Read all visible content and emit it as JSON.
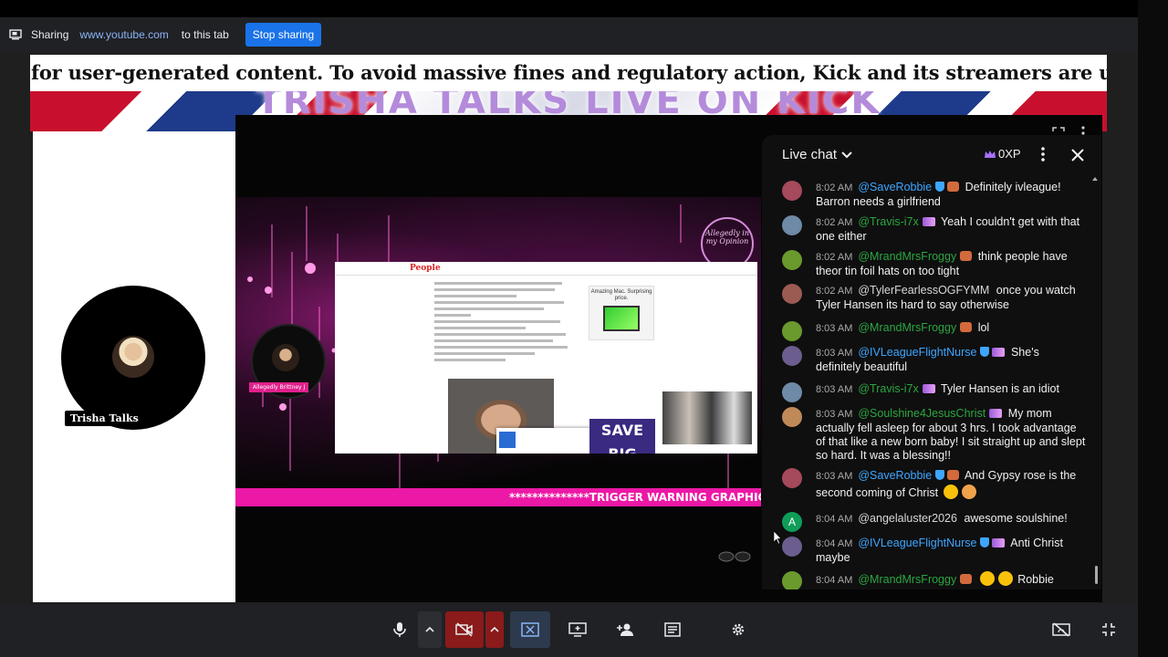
{
  "share_bar": {
    "label": "Sharing",
    "url": "www.youtube.com",
    "suffix": "to this tab",
    "stop_button": "Stop sharing"
  },
  "stream": {
    "ticker_text": "for user-generated content. To avoid massive fines and regulatory action, Kick and its streamers are utilising age",
    "banner_title": "TRISHA TALKS LIVE ON KICK",
    "host_name": "Trisha Talks",
    "guest_name": "Allegedly Brittney J",
    "logo_text": "Allegedly in my Opinion",
    "warning_text": "**************TRIGGER WARNING GRAPHIC DI",
    "article": {
      "brand": "People",
      "ad_title": "Amazing Mac. Surprising price.",
      "save_big": "SAVE BIG"
    }
  },
  "chat": {
    "title": "Live chat",
    "xp": "0XP",
    "messages": [
      {
        "time": "8:02 AM",
        "author": "@SaveRobbie",
        "text": "Definitely ivleague! Barron needs a girlfriend",
        "color": "blue"
      },
      {
        "time": "8:02 AM",
        "author": "@Travis-i7x",
        "text": "Yeah I couldn't get with that one either",
        "color": "green"
      },
      {
        "time": "8:02 AM",
        "author": "@MrandMrsFroggy",
        "text": "think people have theor tin foil hats on too tight",
        "color": "green"
      },
      {
        "time": "8:02 AM",
        "author": "@TylerFearlessOGFYMM",
        "text": "once you watch Tyler Hansen its hard to say otherwise",
        "color": "gray"
      },
      {
        "time": "8:03 AM",
        "author": "@MrandMrsFroggy",
        "text": "lol",
        "color": "green"
      },
      {
        "time": "8:03 AM",
        "author": "@IVLeagueFlightNurse",
        "text": "She's definitely beautiful",
        "color": "blue"
      },
      {
        "time": "8:03 AM",
        "author": "@Travis-i7x",
        "text": "Tyler Hansen is an idiot",
        "color": "green"
      },
      {
        "time": "8:03 AM",
        "author": "@Soulshine4JesusChrist",
        "text": "My mom actually fell asleep for about 3 hrs. I took advantage of that like a new born baby! I sit straight up and slept so hard. It was a blessing!!",
        "color": "green"
      },
      {
        "time": "8:03 AM",
        "author": "@SaveRobbie",
        "text": "And Gypsy rose is the second coming of Christ",
        "color": "blue"
      },
      {
        "time": "8:04 AM",
        "author": "@angelaluster2026",
        "text": "awesome soulshine!",
        "color": "gray"
      },
      {
        "time": "8:04 AM",
        "author": "@IVLeagueFlightNurse",
        "text": "Anti Christ maybe",
        "color": "blue"
      },
      {
        "time": "8:04 AM",
        "author": "@MrandMrsFroggy",
        "text": "Robbie",
        "color": "green"
      }
    ],
    "avatar_letter": "A"
  },
  "toolbar": {
    "icons": [
      "mic-icon",
      "mic-options-icon",
      "camera-off-icon",
      "camera-options-icon",
      "stop-present-icon",
      "present-icon",
      "add-people-icon",
      "captions-icon",
      "settings-icon",
      "hide-self-icon",
      "fullscreen-icon"
    ],
    "colors": {
      "camera_off_bg": "#8b1a1a",
      "present_active": "#8ab4f8"
    }
  }
}
